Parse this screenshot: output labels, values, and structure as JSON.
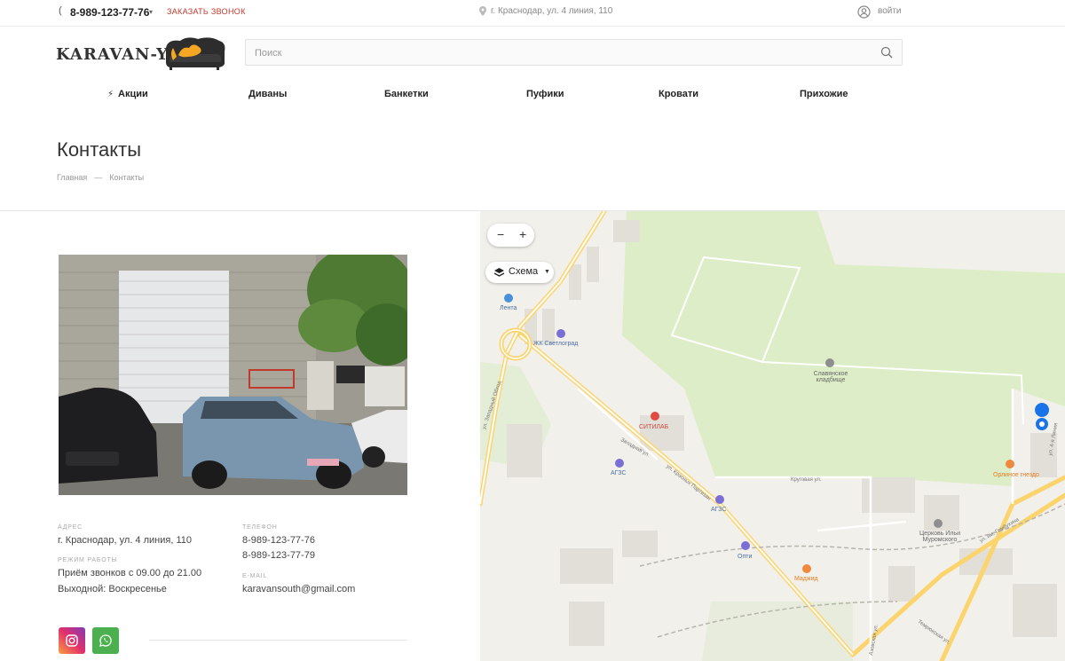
{
  "topbar": {
    "phone": "8-989-123-77-76",
    "callback": "ЗАКАЗАТЬ ЗВОНОК",
    "address": "г. Краснодар, ул. 4 линия, 110",
    "login": "войти"
  },
  "header": {
    "logo_text": "KARAVAN-YG",
    "search_placeholder": "Поиск"
  },
  "nav": [
    {
      "label": "Акции"
    },
    {
      "label": "Диваны"
    },
    {
      "label": "Банкетки"
    },
    {
      "label": "Пуфики"
    },
    {
      "label": "Кровати"
    },
    {
      "label": "Прихожие"
    }
  ],
  "page": {
    "title": "Контакты",
    "breadcrumb": [
      "Главная",
      "—",
      "Контакты"
    ]
  },
  "contacts": {
    "address_label": "АДРЕС",
    "address": "г. Краснодар, ул. 4 линия, 110",
    "hours_label": "РЕЖИМ РАБОТЫ",
    "hours_line1": "Приём звонков с 09.00 до 21.00",
    "hours_line2": "Выходной: Воскресенье",
    "phone_label": "ТЕЛЕФОН",
    "phone1": "8-989-123-77-76",
    "phone2": "8-989-123-77-79",
    "email_label": "E-MAIL",
    "email": "karavansouth@gmail.com"
  },
  "map": {
    "zoom_out": "−",
    "zoom_in": "+",
    "layer_label": "Схема",
    "pois": {
      "lenta": "Лента",
      "svetlograd": "ЖК Светлоград",
      "cemetery": "Славянское\nкладбище",
      "sitilab": "СИТИЛАБ",
      "ags1": "АГЗС",
      "ags2": "АГЗС",
      "orlinoe": "Орлиное гнездо",
      "church": "Церковь Ильи\nМуромского",
      "opti": "Опти",
      "madjid": "Маджид"
    },
    "streets": {
      "west_bypass": "ул. Западный Обход",
      "krasnykh_partizan": "ул. Красных Партизан",
      "zapadnaya": "Западная ул.",
      "krugovaya": "Круговая ул.",
      "gombukhina": "ул. им. Гомбухина",
      "azovskaya": "Азовская ул.",
      "tekhnicheskaya": "Темрюкская ул.",
      "line4": "ул. 4-я Линия"
    },
    "colors": {
      "park": "#dcedc8",
      "road_major": "#fbd46d",
      "accent_red": "#d0463e"
    }
  }
}
